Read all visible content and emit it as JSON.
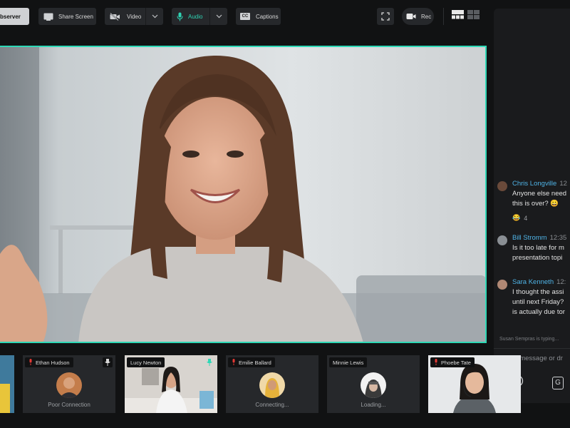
{
  "toolbar": {
    "observer_label": "bserver",
    "share_label": "Share Screen",
    "video_label": "Video",
    "audio_label": "Audio",
    "captions_label": "Captions",
    "captions_badge": "CC",
    "rec_label": "Rec"
  },
  "icons": {
    "share": "screen-icon",
    "video": "video-off-icon",
    "audio": "microphone-icon",
    "fullscreen": "fullscreen-icon",
    "rec": "camera-icon",
    "layout_grid": "layout-icon",
    "pin": "pin-icon",
    "emoji": "smiley-icon",
    "gif": "gif-icon"
  },
  "colors": {
    "accent": "#2ed8b6",
    "chat_name": "#4fb3e6",
    "muted": "#e53935",
    "bg": "#111213"
  },
  "chat": {
    "messages": [
      {
        "name": "Chris Longville",
        "time": "12",
        "lines": [
          "Anyone else need",
          "this is over? 😀"
        ],
        "reaction": "😂",
        "reaction_count": "4"
      },
      {
        "name": "Bill Stromm",
        "time": "12:35",
        "lines": [
          "Is it too late for m",
          "presentation topi"
        ]
      },
      {
        "name": "Sara Kenneth",
        "time": "12:",
        "lines": [
          "I thought the assi",
          "until next Friday?",
          "is actually due tor"
        ]
      }
    ],
    "typing_text": "Susan Sempras is typing...",
    "input_placeholder": "Type message or dr",
    "gif_label": "G"
  },
  "participants": [
    {
      "name": "Ethan Hudson",
      "status": "Poor Connection",
      "muted": true,
      "pinned": true
    },
    {
      "name": "Lucy Newton",
      "status": "",
      "muted": false,
      "pinned": true
    },
    {
      "name": "Emilie Ballard",
      "status": "Connecting...",
      "muted": true,
      "pinned": false
    },
    {
      "name": "Minnie Lewis",
      "status": "Loading...",
      "muted": false,
      "pinned": false
    },
    {
      "name": "Phoebe Tate",
      "status": "",
      "muted": true,
      "pinned": false
    }
  ]
}
